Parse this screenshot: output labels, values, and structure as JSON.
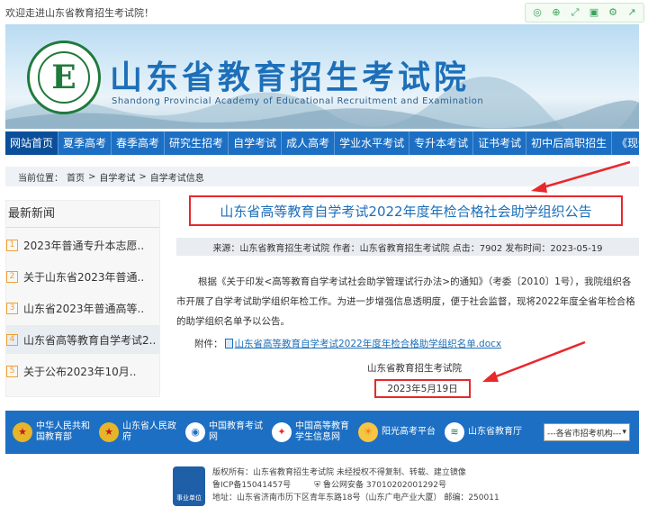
{
  "header": {
    "welcome": "欢迎走进山东省教育招生考试院！"
  },
  "toolbar_icons": [
    "read-aloud-icon",
    "zoom-icon",
    "expand-icon",
    "screen-icon",
    "settings-icon",
    "external-icon"
  ],
  "banner": {
    "logo_letter": "E",
    "title": "山东省教育招生考试院",
    "subtitle": "Shandong Provincial Academy of Educational Recruitment and Examination"
  },
  "nav": {
    "items": [
      "网站首页",
      "夏季高考",
      "春季高考",
      "研究生招考",
      "自学考试",
      "成人高考",
      "学业水平考试",
      "专升本考试",
      "证书考试",
      "初中后高职招生",
      "《现代教育》"
    ]
  },
  "breadcrumb": {
    "label": "当前位置：",
    "items": [
      "首页",
      "自学考试",
      "自学考试信息"
    ],
    "separator": ">"
  },
  "sidebar": {
    "title": "最新新闻",
    "items": [
      {
        "num": "1",
        "text": "2023年普通专升本志愿.."
      },
      {
        "num": "2",
        "text": "关于山东省2023年普通.."
      },
      {
        "num": "3",
        "text": "山东省2023年普通高等.."
      },
      {
        "num": "4",
        "text": "山东省高等教育自学考试2.."
      },
      {
        "num": "5",
        "text": "关于公布2023年10月.."
      }
    ]
  },
  "article": {
    "title": "山东省高等教育自学考试2022年度年检合格社会助学组织公告",
    "meta": "来源：山东省教育招生考试院 作者：山东省教育招生考试院 点击：7902 发布时间：2023-05-19",
    "body": "根据《关于印发<高等教育自学考试社会助学管理试行办法>的通知》（考委〔2010〕1号），我院组织各市开展了自学考试助学组织年检工作。为进一步增强信息透明度，便于社会监督，现将2022年度全省年检合格的助学组织名单予以公告。",
    "attachment_label": "附件：",
    "attachment_link": "山东省高等教育自学考试2022年度年检合格助学组织名单.docx",
    "signature": "山东省教育招生考试院",
    "date": "2023年5月19日"
  },
  "footer": {
    "links": [
      {
        "line1": "中华人民共和",
        "line2": "国教育部"
      },
      {
        "line1": "山东省人民政",
        "line2": "府"
      },
      {
        "line1": "中国教育考试",
        "line2": "网"
      },
      {
        "line1": "中国高等教育",
        "line2": "学生信息网"
      },
      {
        "line1": "阳光高考平台",
        "line2": ""
      },
      {
        "line1": "山东省教育厅",
        "line2": ""
      }
    ],
    "select_placeholder": "---各省市招考机构---",
    "badge": "事业单位",
    "copyright": "版权所有：山东省教育招生考试院 未经授权不得复制、转载、建立镜像",
    "icp": "鲁ICP备15041457号",
    "police": "鲁公网安备 37010202001292号",
    "address": "地址：山东省济南市历下区青年东路18号（山东广电产业大厦） 邮编：250011"
  },
  "colors": {
    "nav_blue": "#1c6fc3",
    "title_blue": "#1d6fb8",
    "highlight_red": "#e8282b",
    "logo_green": "#1f7a3b"
  }
}
